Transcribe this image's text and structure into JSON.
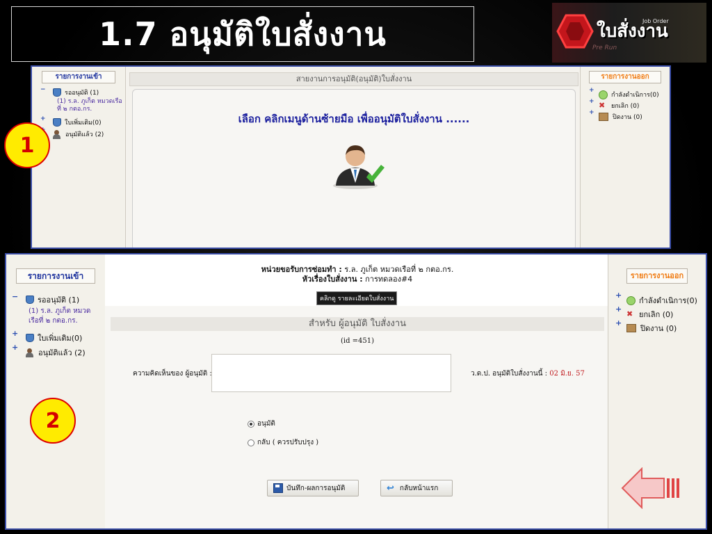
{
  "slide": {
    "title": "1.7 อนุมัติใบสั่งงาน",
    "logo_text": "ใบสั่งงาน",
    "logo_sub": "Job Order",
    "logo_run": "Pre Run"
  },
  "panel1": {
    "left_header": "รายการงานเข้า",
    "pending": "รออนุมัติ (1)",
    "pending_item": "(1) ร.ล. ภูเก็ต หมวดเรือที่ ๒ กตอ.กร.",
    "extra": "ใบเพิ่มเติม(0)",
    "approved": "อนุมัติแล้ว (2)",
    "center_header": "สายงานการอนุมัติ(อนุมัติ)ใบสั่งงาน",
    "center_message": "เลือก คลิกเมนูด้านซ้ายมือ เพื่ออนุมัติใบสั่งงาน ......",
    "right_header": "รายการงานออก",
    "in_progress": "กำลังดำเนิการ(0)",
    "cancelled": "ยกเลิก (0)",
    "closed": "ปิดงาน (0)"
  },
  "panel2": {
    "left_header": "รายการงานเข้า",
    "pending": "รออนุมัติ (1)",
    "pending_item": "(1) ร.ล. ภูเก็ต หมวดเรือที่ ๒ กตอ.กร.",
    "extra": "ใบเพิ่มเติม(0)",
    "approved": "อนุมัติแล้ว (2)",
    "unit_label": "หน่วยขอรับการซ่อมทำ :",
    "unit_value": "ร.ล. ภูเก็ต หมวดเรือที่ ๒ กตอ.กร.",
    "subject_label": "หัวเรื่องใบสั่งงาน :",
    "subject_value": "การทดลอง#4",
    "detail_button": "คลิกดู รายละเอียดใบสั่งงาน",
    "form_header": "สำหรับ ผู้อนุมัติ ใบสั่งงาน",
    "form_id": "(id =451)",
    "comment_label": "ความคิดเห็นของ ผู้อนุมัติ :",
    "comment_value": "",
    "date_label": "ว.ด.ป. อนุมัติใบสั่งงานนี้ :",
    "date_value": "02 มิ.ย. 57",
    "radio_approve": "อนุมัติ",
    "radio_return": "กลับ ( ควรปรับปรุง )",
    "save_button": "บันทึก-ผลการอนุมัติ",
    "back_button": "กลับหน้าแรก",
    "right_header": "รายการงานออก",
    "in_progress": "กำลังดำเนิการ(0)",
    "cancelled": "ยกเลิก (0)",
    "closed": "ปิดงาน (0)"
  },
  "badges": {
    "one": "1",
    "two": "2"
  },
  "tree_markers": {
    "minus": "−",
    "plus": "+"
  },
  "colors": {
    "accent_blue": "#1a2f9c",
    "accent_orange": "#f07a10",
    "badge_yellow": "#ffeb00",
    "badge_red": "#d40000",
    "date_red": "#c0181c"
  },
  "icons": [
    "shield-icon",
    "user-check-icon",
    "green-circle-icon",
    "cancel-icon",
    "box-icon",
    "save-icon",
    "back-arrow-icon",
    "person-approve-icon",
    "hexagon-logo-icon",
    "left-arrow-icon"
  ]
}
